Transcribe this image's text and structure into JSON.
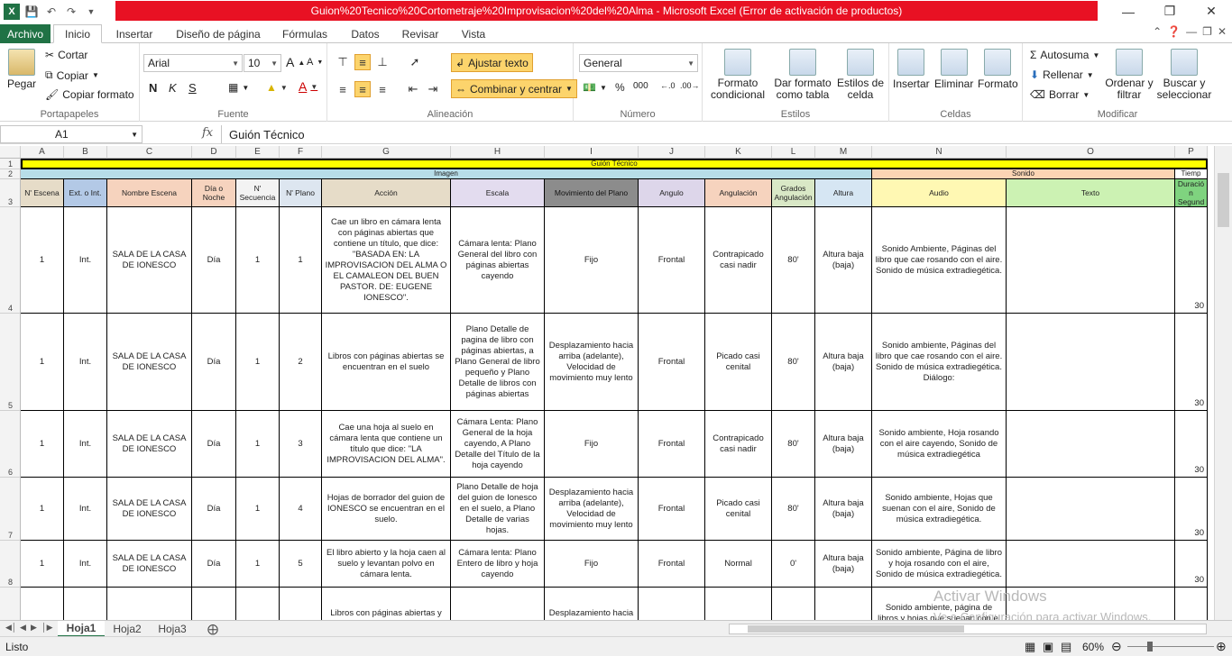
{
  "window": {
    "title": "Guion%20Tecnico%20Cortometraje%20Improvisacion%20del%20Alma  -  Microsoft Excel (Error de activación de productos)",
    "title_bg": "#e81123"
  },
  "tabs": [
    "Archivo",
    "Inicio",
    "Insertar",
    "Diseño de página",
    "Fórmulas",
    "Datos",
    "Revisar",
    "Vista"
  ],
  "ribbon": {
    "clipboard": {
      "paste": "Pegar",
      "cut": "Cortar",
      "copy": "Copiar",
      "format_painter": "Copiar formato",
      "label": "Portapapeles"
    },
    "font": {
      "name": "Arial",
      "size": "10",
      "label": "Fuente"
    },
    "alignment": {
      "wrap": "Ajustar texto",
      "merge": "Combinar y centrar",
      "label": "Alineación"
    },
    "number": {
      "format": "General",
      "label": "Número"
    },
    "styles": {
      "conditional": "Formato condicional",
      "as_table": "Dar formato como tabla",
      "cell_styles": "Estilos de celda",
      "label": "Estilos"
    },
    "cells": {
      "insert": "Insertar",
      "delete": "Eliminar",
      "format": "Formato",
      "label": "Celdas"
    },
    "editing": {
      "autosum": "Autosuma",
      "fill": "Rellenar",
      "clear": "Borrar",
      "sort": "Ordenar y filtrar",
      "find": "Buscar y seleccionar",
      "label": "Modificar"
    }
  },
  "formula_bar": {
    "name_box": "A1",
    "fx": "fx",
    "content": "Guión Técnico"
  },
  "columns": [
    "A",
    "B",
    "C",
    "D",
    "E",
    "F",
    "G",
    "H",
    "I",
    "J",
    "K",
    "L",
    "M",
    "N",
    "O",
    "P"
  ],
  "sheet": {
    "row1_title": "Guión Técnico",
    "row2_imagen": "Imagen",
    "row2_sonido": "Sonido",
    "row2_tiempo": "Tiemp",
    "headers": [
      "N' Escena",
      "Ext. o Int.",
      "Nombre Escena",
      "Día o Noche",
      "N' Secuencia",
      "N' Plano",
      "Acción",
      "Escala",
      "Movimiento del Plano",
      "Angulo",
      "Angulación",
      "Grados Angulación",
      "Altura",
      "Audio",
      "Texto",
      "Duració n Segund"
    ],
    "rows": [
      {
        "num": "4",
        "cells": [
          "1",
          "Int.",
          "SALA DE LA CASA DE IONESCO",
          "Día",
          "1",
          "1",
          "Cae un libro en cámara lenta con páginas abiertas que contiene un título, que dice: \"BASADA EN: LA IMPROVISACION DEL ALMA O EL CAMALEON DEL BUEN PASTOR. DE: EUGENE IONESCO\".",
          "Cámara lenta: Plano General del libro con páginas abiertas cayendo",
          "Fijo",
          "Frontal",
          "Contrapicado casi nadir",
          "80'",
          "Altura baja (baja)",
          "Sonido Ambiente, Páginas del libro que cae rosando con el aire. Sonido de música extradiegética.",
          "",
          "30"
        ]
      },
      {
        "num": "5",
        "cells": [
          "1",
          "Int.",
          "SALA DE LA CASA DE IONESCO",
          "Día",
          "1",
          "2",
          "Libros con páginas abiertas se encuentran en el suelo",
          "Plano Detalle de pagina de libro con páginas abiertas, a Plano General de libro pequeño y Plano Detalle de libros con páginas abiertas",
          "Desplazamiento hacia arriba (adelante), Velocidad de movimiento muy lento",
          "Frontal",
          "Picado casi cenital",
          "80'",
          "Altura baja (baja)",
          "Sonido ambiente, Páginas del libro que cae rosando con el aire. Sonido de música extradiegética. Diálogo:",
          "",
          "30"
        ]
      },
      {
        "num": "6",
        "cells": [
          "1",
          "Int.",
          "SALA DE LA CASA DE IONESCO",
          "Día",
          "1",
          "3",
          "Cae una hoja al suelo en cámara lenta que contiene un título que dice: \"LA IMPROVISACION DEL ALMA\".",
          "Cámara Lenta: Plano General de la hoja cayendo, A Plano Detalle del Título de la hoja cayendo",
          "Fijo",
          "Frontal",
          "Contrapicado casi nadir",
          "80'",
          "Altura baja (baja)",
          "Sonido ambiente, Hoja rosando con el aire cayendo, Sonido de música extradiegética",
          "",
          "30"
        ]
      },
      {
        "num": "7",
        "cells": [
          "1",
          "Int.",
          "SALA DE LA CASA DE IONESCO",
          "Día",
          "1",
          "4",
          "Hojas de borrador del guion de IONESCO se encuentran en el suelo.",
          "Plano Detalle de hoja del guion de Ionesco en el suelo,  a Plano Detalle de varias hojas.",
          "Desplazamiento hacia arriba (adelante), Velocidad de movimiento muy lento",
          "Frontal",
          "Picado casi cenital",
          "80'",
          "Altura baja (baja)",
          "Sonido ambiente, Hojas que suenan con el aire, Sonido de música extradiegética.",
          "",
          "30"
        ]
      },
      {
        "num": "8",
        "cells": [
          "1",
          "Int.",
          "SALA DE LA CASA DE IONESCO",
          "Día",
          "1",
          "5",
          "El libro abierto y la hoja caen al suelo y levantan polvo en cámara lenta.",
          "Cámara lenta: Plano Entero de libro y hoja cayendo",
          "Fijo",
          "Frontal",
          "Normal",
          "0'",
          "Altura baja (baja)",
          "Sonido ambiente, Página de libro y hoja rosando con el aire, Sonido de música extradiegética.",
          "",
          "30"
        ]
      },
      {
        "num": "",
        "cells": [
          "",
          "",
          "",
          "",
          "",
          "",
          "Libros con páginas abiertas y hojas de borrador de guion de",
          "",
          "Desplazamiento hacia adelante bajando la",
          "",
          "",
          "",
          "",
          "Sonido ambiente, página de libros y hojas que suenan con el aire,",
          "",
          ""
        ]
      }
    ]
  },
  "sheets": [
    "Hoja1",
    "Hoja2",
    "Hoja3"
  ],
  "status": {
    "ready": "Listo",
    "zoom": "60%"
  },
  "watermark": {
    "line1": "Activar Windows",
    "line2": "Ve a Configuración para activar Windows."
  }
}
